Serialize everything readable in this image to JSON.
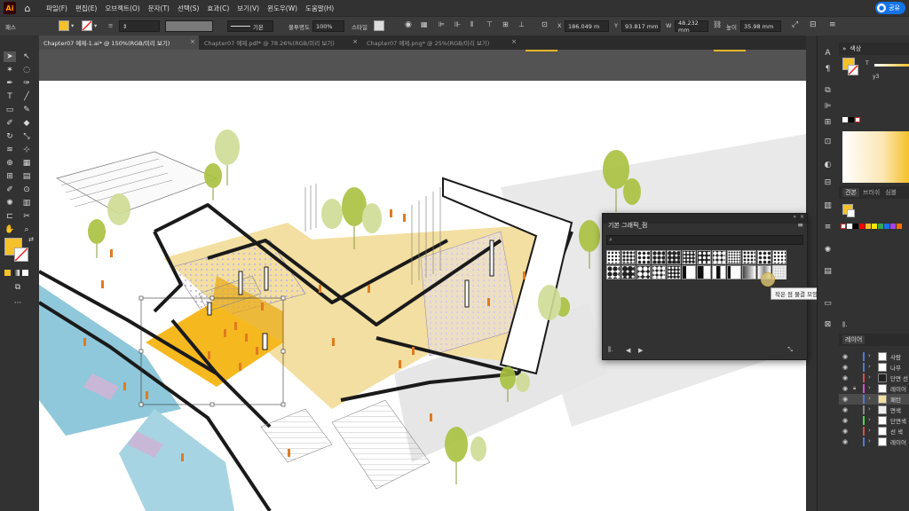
{
  "app": {
    "logo": "Ai"
  },
  "menus": [
    "파일(F)",
    "편집(E)",
    "오브젝트(O)",
    "문자(T)",
    "선택(S)",
    "효과(C)",
    "보기(V)",
    "윈도우(W)",
    "도움말(H)"
  ],
  "share_label": "공유",
  "control_bar": {
    "selection_label": "패스",
    "stroke_style_label": "기본",
    "opacity_label": "불투명도",
    "opacity_value": "100%",
    "style_label": "스타일",
    "x_value": "186.049 m",
    "y_value": "93.817 mm",
    "width_value": "48.232 mm",
    "height_label": "높이",
    "height_value": "35.98 mm",
    "fill_color": "#F5C12A"
  },
  "tabs": [
    {
      "label": "Chapter07 예제-1.ai* @ 150%(RGB/미리 보기)",
      "active": true
    },
    {
      "label": "Chapter07 예제.pdf* @ 78.26%(RGB/미리 보기)",
      "active": false
    },
    {
      "label": "Chapter07 예제.png* @ 25%(RGB/미리 보기)",
      "active": false
    }
  ],
  "tab_close_icon": "×",
  "color_panel": {
    "title": "색상",
    "swatch_value": "y3",
    "fill_color": "#F5C12A"
  },
  "swatches_panel": {
    "tabs": [
      "견본",
      "브러쉬",
      "심볼"
    ],
    "colors": [
      "#ffffff",
      "#000000",
      "#ff0000",
      "#f5c12a",
      "#ffe600",
      "#34a853",
      "#1a73e8",
      "#a142f4",
      "#ff6d00",
      "#00bcd4",
      "#8d6e63",
      "#9e9e9e"
    ]
  },
  "layers_panel": {
    "title": "레이어",
    "layers": [
      {
        "name": "사람",
        "color": "#4f7bd6",
        "locked": false,
        "selected": false
      },
      {
        "name": "나무",
        "color": "#4f7bd6",
        "locked": false,
        "selected": false
      },
      {
        "name": "단면 선",
        "color": "#d64f4f",
        "locked": false,
        "selected": false
      },
      {
        "name": "레이어",
        "color": "#d64fd6",
        "locked": true,
        "selected": false
      },
      {
        "name": "패턴",
        "color": "#4f7bd6",
        "locked": false,
        "selected": true
      },
      {
        "name": "면색",
        "color": "#888888",
        "locked": false,
        "selected": false
      },
      {
        "name": "단면색",
        "color": "#4fd64f",
        "locked": false,
        "selected": false
      },
      {
        "name": "선 색",
        "color": "#d64f4f",
        "locked": false,
        "selected": false
      },
      {
        "name": "레이어",
        "color": "#4f7bd6",
        "locked": false,
        "selected": false
      }
    ]
  },
  "graphic_styles_panel": {
    "title": "기본 그래픽_점",
    "tooltip": "작은 점 물결 모양"
  },
  "accent_colors": {
    "highlight_yellow": "#F5C12A",
    "floor_tan": "#F3DFA1",
    "pool_blue": "#8FC8DA",
    "tree_green": "#A9C23F",
    "people_orange": "#E07A1F"
  }
}
